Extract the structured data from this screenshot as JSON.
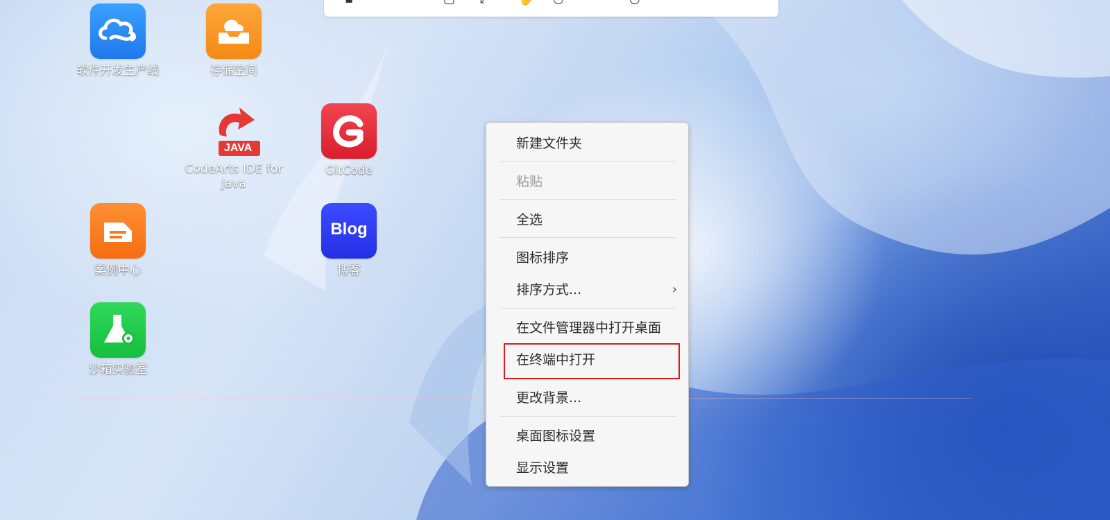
{
  "desktop_icons": [
    {
      "label": "软件开发生产线",
      "icon": "cloud-pipeline-icon",
      "color": "#2e8cf5"
    },
    {
      "label": "存储空间",
      "icon": "storage-tray-icon",
      "color": "#f7931e"
    },
    {
      "label": "CodeArts IDE for Java",
      "icon": "java-ide-icon",
      "badge": "JAVA",
      "color": "#e53935"
    },
    {
      "label": "GitCode",
      "icon": "gitcode-logo-icon",
      "color": "#e8313f"
    },
    {
      "label": "案例中心",
      "icon": "case-center-icon",
      "color": "#f7781e"
    },
    {
      "label": "博客",
      "icon": "blog-logo-icon",
      "badge": "Blog",
      "color": "#2d3bf0"
    },
    {
      "label": "沙箱实验室",
      "icon": "sandbox-lab-icon",
      "color": "#1ec94a"
    }
  ],
  "context_menu": {
    "items": [
      {
        "label": "新建文件夹",
        "enabled": true
      },
      {
        "label": "粘贴",
        "enabled": false
      },
      {
        "label": "全选",
        "enabled": true
      },
      {
        "label": "图标排序",
        "enabled": true
      },
      {
        "label": "排序方式...",
        "enabled": true,
        "submenu": true
      },
      {
        "label": "在文件管理器中打开桌面",
        "enabled": true
      },
      {
        "label": "在终端中打开",
        "enabled": true,
        "highlighted": true
      },
      {
        "label": "更改背景...",
        "enabled": true
      },
      {
        "label": "桌面图标设置",
        "enabled": true
      },
      {
        "label": "显示设置",
        "enabled": true
      }
    ],
    "submenu_glyph": "›"
  },
  "colors": {
    "highlight_border": "#e01818",
    "menu_bg": "#f6f6f6"
  }
}
